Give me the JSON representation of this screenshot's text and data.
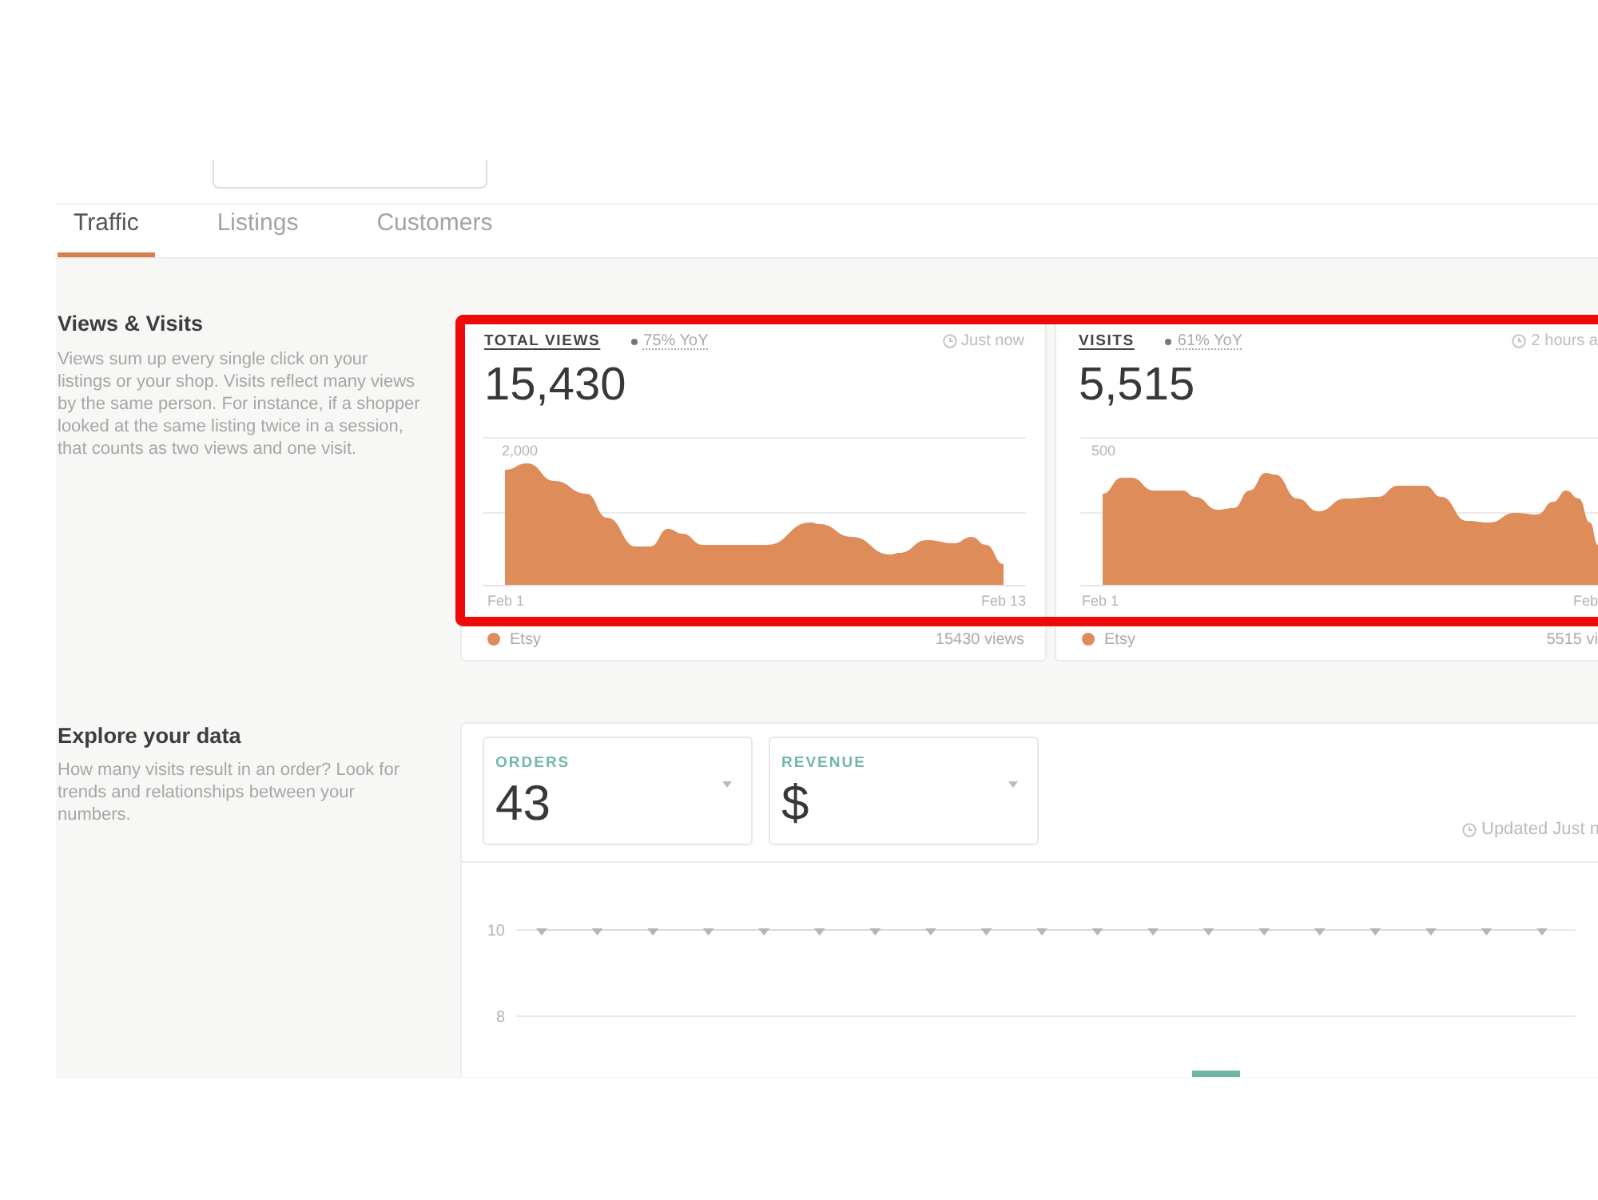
{
  "tabs": [
    {
      "label": "Traffic",
      "selected": true
    },
    {
      "label": "Listings",
      "selected": false
    },
    {
      "label": "Customers",
      "selected": false
    }
  ],
  "views_visits": {
    "title": "Views & Visits",
    "description": "Views sum up every single click on your listings or your shop. Visits reflect many views by the same person. For instance, if a shopper looked at the same listing twice in a session, that counts as two views and one visit.",
    "highlighted": true,
    "cards": [
      {
        "title": "TOTAL VIEWS",
        "change": "75% YoY",
        "updated": "Just now",
        "value": "15,430",
        "axis_label": "2,000",
        "x_start": "Feb 1",
        "x_end": "Feb 13",
        "legend": {
          "name": "Etsy",
          "color": "#dd8c5a",
          "total": "15430 views"
        }
      },
      {
        "title": "VISITS",
        "change": "61% YoY",
        "updated": "2 hours a",
        "value": "5,515",
        "axis_label": "500",
        "x_start": "Feb 1",
        "x_end": "Feb",
        "legend": {
          "name": "Etsy",
          "color": "#dd8c5a",
          "total": "5515 vi"
        }
      }
    ]
  },
  "explore": {
    "title": "Explore your data",
    "description": "How many visits result in an order? Look for trends and relationships between your numbers.",
    "metrics": [
      {
        "label": "ORDERS",
        "value": "43"
      },
      {
        "label": "REVENUE",
        "value": "$"
      }
    ],
    "updated": "Updated Just n",
    "chart_data": {
      "type": "line",
      "ylim": [
        8,
        10
      ],
      "yticks": [
        8,
        10
      ],
      "series": [
        {
          "marker": "triangle",
          "values": [
            10,
            10,
            10,
            10,
            10,
            10,
            10,
            10,
            10,
            10,
            10,
            10,
            10,
            10,
            10,
            10,
            10,
            10,
            10
          ]
        }
      ]
    }
  }
}
